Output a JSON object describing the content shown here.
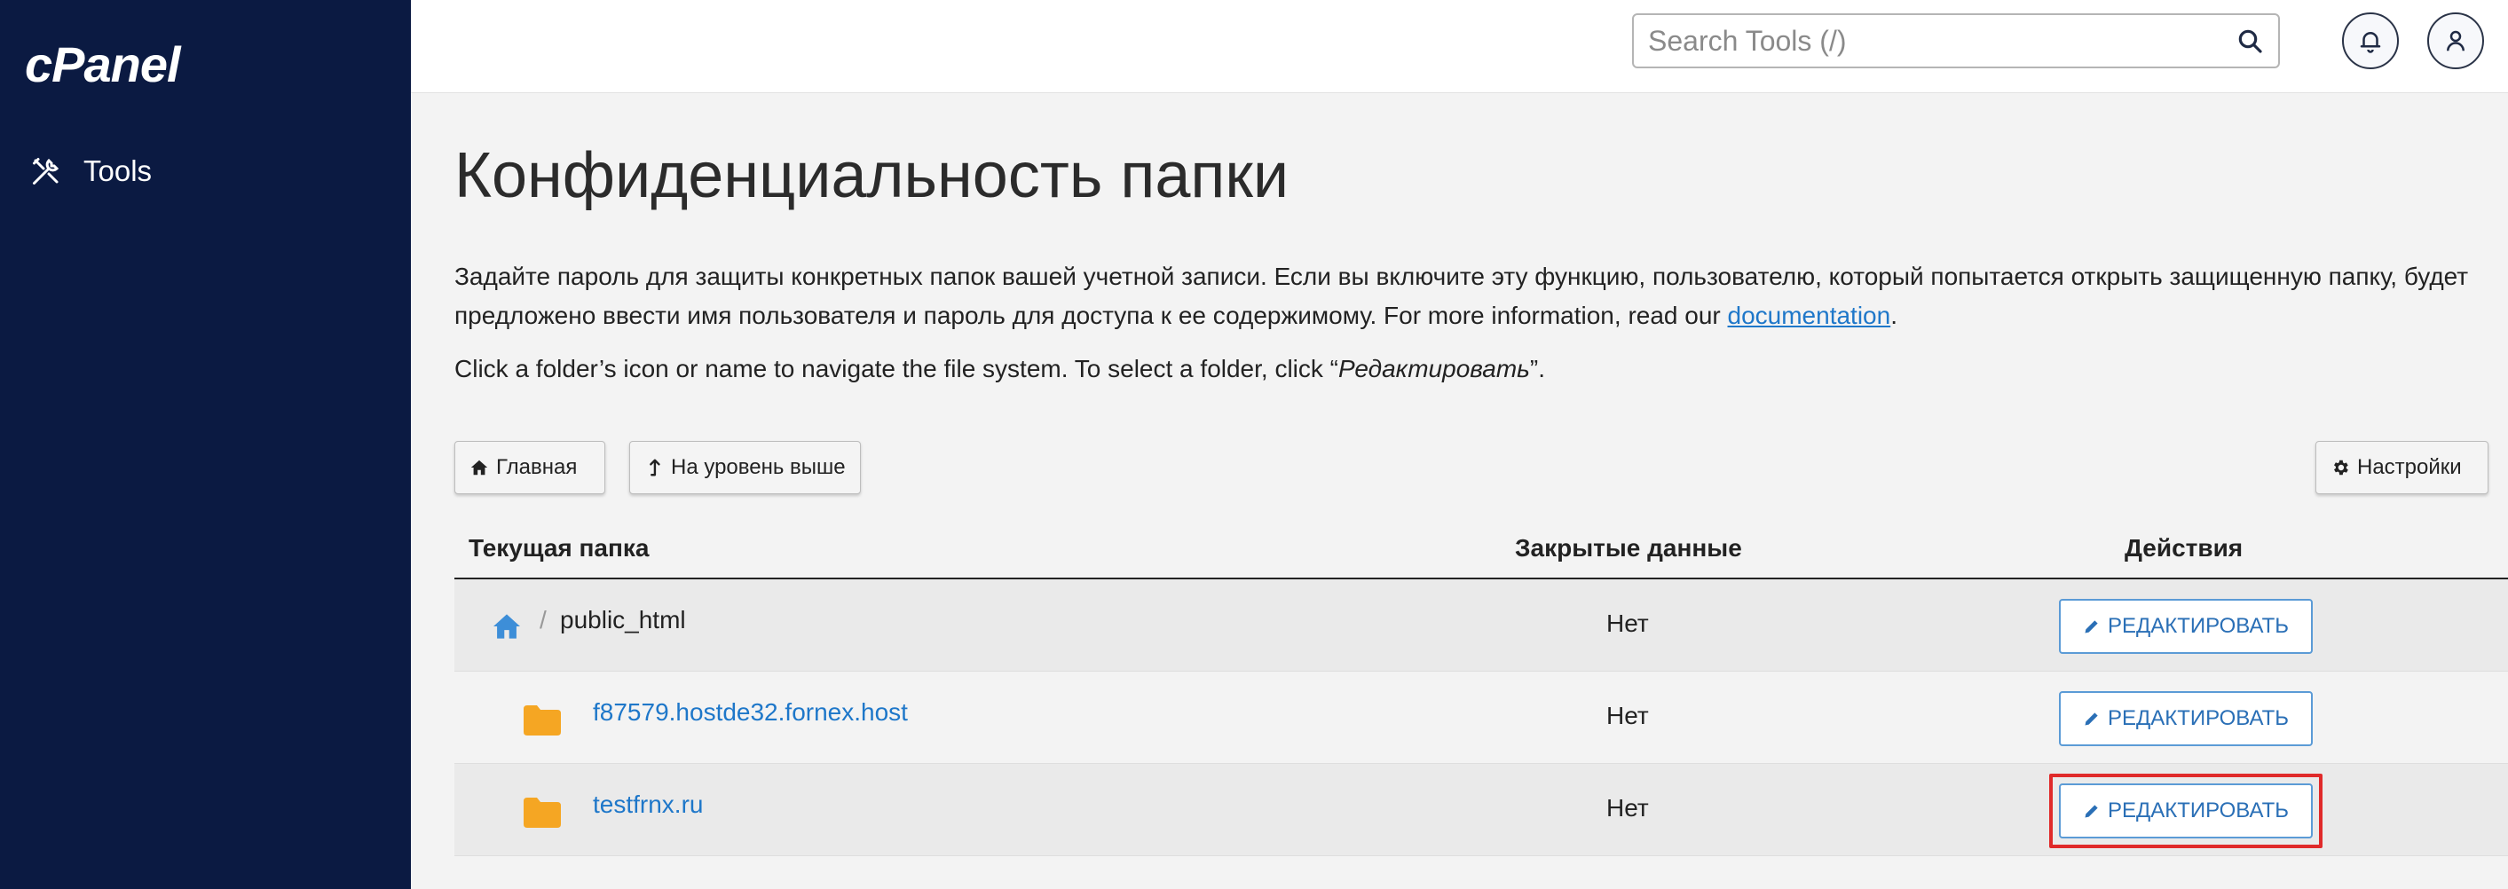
{
  "brand": {
    "logo_text": "cPanel"
  },
  "sidebar": {
    "items": [
      {
        "label": "Tools",
        "icon": "tools-icon"
      }
    ]
  },
  "topbar": {
    "search_placeholder": "Search Tools (/)",
    "search_value": ""
  },
  "page": {
    "title": "Конфиденциальность папки",
    "description": "Задайте пароль для защиты конкретных папок вашей учетной записи. Если вы включите эту функцию, пользователю, который попытается открыть защищенную папку, будет предложено ввести имя пользователя и пароль для доступа к ее содержимому. For more information, read our ",
    "doc_link": "documentation",
    "doc_suffix": ".",
    "hint_prefix": "Click a folder’s icon or name to navigate the file system. To select a folder, click “",
    "hint_em": "Редактировать",
    "hint_suffix": "”."
  },
  "toolbar": {
    "home_label": "Главная",
    "up_label": "На уровень выше",
    "settings_label": "Настройки"
  },
  "table": {
    "headers": {
      "folder": "Текущая папка",
      "protected": "Закрытые данные",
      "actions": "Действия"
    },
    "root": {
      "separator": "/",
      "name": "public_html",
      "protected": "Нет",
      "action": "РЕДАКТИРОВАТЬ"
    },
    "rows": [
      {
        "name": "f87579.hostde32.fornex.host",
        "protected": "Нет",
        "action": "РЕДАКТИРОВАТЬ"
      },
      {
        "name": "testfrnx.ru",
        "protected": "Нет",
        "action": "РЕДАКТИРОВАТЬ"
      }
    ]
  },
  "colors": {
    "sidebar_bg": "#0b1a42",
    "link": "#1e77c9",
    "folder": "#f5a623",
    "highlight": "#e02a2a"
  }
}
